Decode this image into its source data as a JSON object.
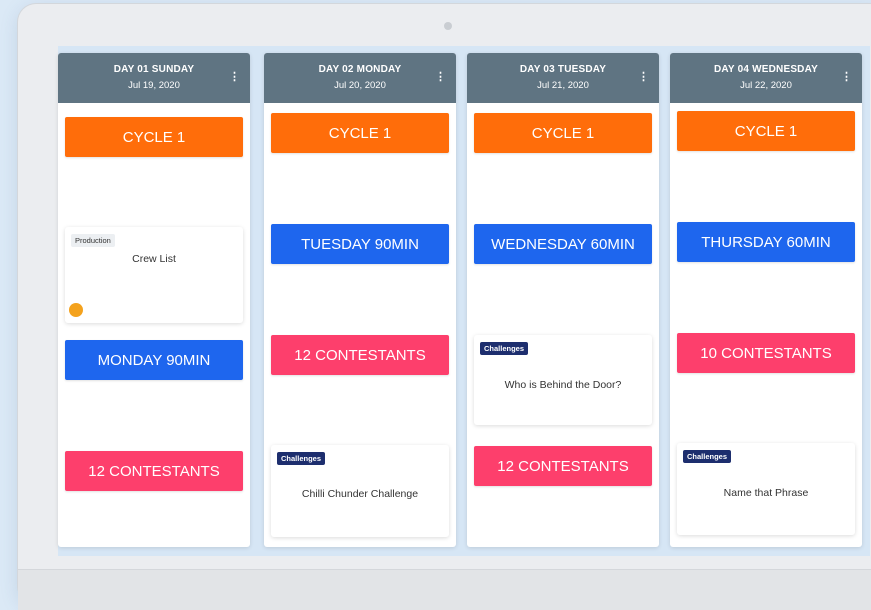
{
  "columns": [
    {
      "day": "DAY 01 SUNDAY",
      "date": "Jul 19, 2020",
      "menu_icon": "kebab-menu-icon",
      "tiles": {
        "cycle": "CYCLE 1",
        "session": "MONDAY 90MIN",
        "contestants": "12 CONTESTANTS"
      },
      "card": {
        "tag": "Production",
        "title": "Crew List"
      }
    },
    {
      "day": "DAY 02 MONDAY",
      "date": "Jul 20, 2020",
      "menu_icon": "kebab-menu-icon",
      "tiles": {
        "cycle": "CYCLE 1",
        "session": "TUESDAY 90MIN",
        "contestants": "12 CONTESTANTS"
      },
      "card": {
        "tag": "Challenges",
        "title": "Chilli Chunder Challenge"
      }
    },
    {
      "day": "DAY 03 TUESDAY",
      "date": "Jul 21, 2020",
      "menu_icon": "kebab-menu-icon",
      "tiles": {
        "cycle": "CYCLE 1",
        "session": "WEDNESDAY 60MIN",
        "contestants": "12 CONTESTANTS"
      },
      "card": {
        "tag": "Challenges",
        "title": "Who is Behind the Door?"
      }
    },
    {
      "day": "DAY 04 WEDNESDAY",
      "date": "Jul 22, 2020",
      "menu_icon": "kebab-menu-icon",
      "tiles": {
        "cycle": "CYCLE 1",
        "session": "THURSDAY 60MIN",
        "contestants": "10 CONTESTANTS"
      },
      "card": {
        "tag": "Challenges",
        "title": "Name that Phrase"
      }
    }
  ],
  "colors": {
    "header": "#5f7482",
    "cycle": "#ff6d0a",
    "session": "#1e66ee",
    "contestants": "#fd3f6c",
    "tag_dark": "#1d2e6e",
    "status_dot": "#f4a21d"
  }
}
